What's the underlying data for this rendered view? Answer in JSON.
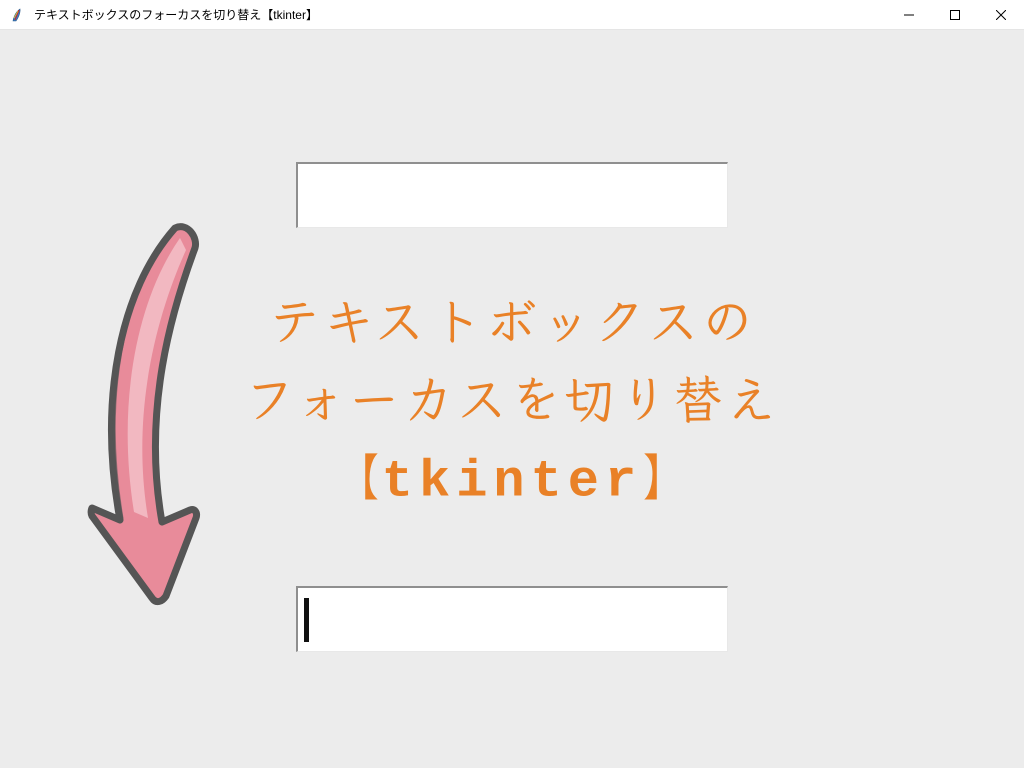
{
  "window": {
    "title": "テキストボックスのフォーカスを切り替え【tkinter】"
  },
  "overlay": {
    "line1": "テキストボックスの",
    "line2": "フォーカスを切り替え",
    "line3_open": "【",
    "line3_mono": "tkinter",
    "line3_close": "】"
  },
  "textbox_top": {
    "value": ""
  },
  "textbox_bottom": {
    "value": ""
  },
  "colors": {
    "accent": "#e98127",
    "arrow_fill": "#e58091",
    "arrow_stroke": "#555555",
    "client_bg": "#ececec"
  }
}
